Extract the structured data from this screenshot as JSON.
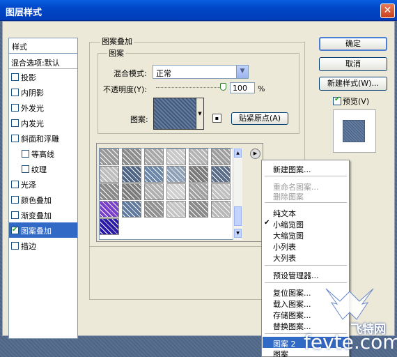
{
  "window": {
    "title": "图层样式",
    "close_icon": "close-icon"
  },
  "style_list": {
    "header": "样式",
    "blend_options": "混合选项:默认",
    "items": [
      {
        "label": "投影",
        "checked": false,
        "indent": false,
        "selected": false
      },
      {
        "label": "内阴影",
        "checked": false,
        "indent": false,
        "selected": false
      },
      {
        "label": "外发光",
        "checked": false,
        "indent": false,
        "selected": false
      },
      {
        "label": "内发光",
        "checked": false,
        "indent": false,
        "selected": false
      },
      {
        "label": "斜面和浮雕",
        "checked": false,
        "indent": false,
        "selected": false
      },
      {
        "label": "等高线",
        "checked": false,
        "indent": true,
        "selected": false
      },
      {
        "label": "纹理",
        "checked": false,
        "indent": true,
        "selected": false
      },
      {
        "label": "光泽",
        "checked": false,
        "indent": false,
        "selected": false
      },
      {
        "label": "颜色叠加",
        "checked": false,
        "indent": false,
        "selected": false
      },
      {
        "label": "渐变叠加",
        "checked": false,
        "indent": false,
        "selected": false
      },
      {
        "label": "图案叠加",
        "checked": true,
        "indent": false,
        "selected": true
      },
      {
        "label": "描边",
        "checked": false,
        "indent": false,
        "selected": false
      }
    ]
  },
  "pattern_overlay": {
    "group_title": "图案叠加",
    "sub_title": "图案",
    "blend_mode_label": "混合模式:",
    "blend_mode_value": "正常",
    "opacity_label": "不透明度(Y):",
    "opacity_value": "100",
    "opacity_unit": "%",
    "opacity_level": 1.0,
    "pattern_label": "图案:",
    "snap_origin_label": "贴紧原点(A)"
  },
  "buttons": {
    "ok": "确定",
    "cancel": "取消",
    "new_style": "新建样式(W)...",
    "preview": "预览(V)",
    "preview_checked": true
  },
  "context_menu": {
    "items": [
      {
        "label": "新建图案...",
        "disabled": false
      },
      {
        "label": "重命名图案...",
        "disabled": true
      },
      {
        "label": "删除图案",
        "disabled": true
      },
      {
        "label": "纯文本",
        "disabled": false
      },
      {
        "label": "小缩览图",
        "disabled": false,
        "checked": true
      },
      {
        "label": "大缩览图",
        "disabled": false
      },
      {
        "label": "小列表",
        "disabled": false
      },
      {
        "label": "大列表",
        "disabled": false
      },
      {
        "label": "预设管理器...",
        "disabled": false
      },
      {
        "label": "复位图案...",
        "disabled": false
      },
      {
        "label": "载入图案...",
        "disabled": false
      },
      {
        "label": "存储图案...",
        "disabled": false
      },
      {
        "label": "替换图案...",
        "disabled": false
      },
      {
        "label": "图案 2",
        "disabled": false,
        "highlighted": true
      },
      {
        "label": "图案",
        "disabled": false
      }
    ]
  },
  "watermark": {
    "site": "fevte.com",
    "brand": "飞特网"
  },
  "colors": {
    "selection": "#3169c6",
    "dialog_bg": "#ece9d8",
    "title_bar": "#0047c8"
  }
}
